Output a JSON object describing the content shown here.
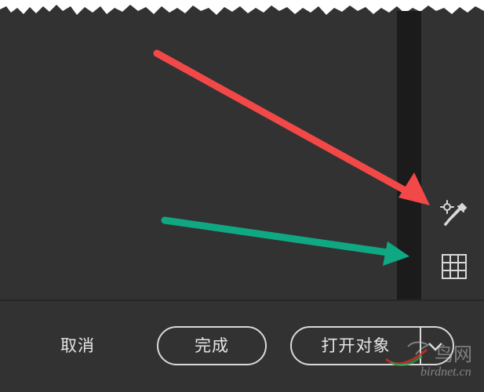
{
  "footer": {
    "cancel_label": "取消",
    "done_label": "完成",
    "open_object_label": "打开对象"
  },
  "tools": {
    "eyedropper": "eyedropper-icon",
    "grid": "grid-icon"
  },
  "annotations": {
    "red_arrow_color": "#f24848",
    "green_arrow_color": "#10a882"
  },
  "watermark": {
    "chinese": "鸟网",
    "url": "birdnet.cn"
  },
  "colors": {
    "panel_bg": "#323232",
    "splitter": "#1b1b1b",
    "text": "#e6e6e6",
    "button_border": "#d9d9d9"
  }
}
